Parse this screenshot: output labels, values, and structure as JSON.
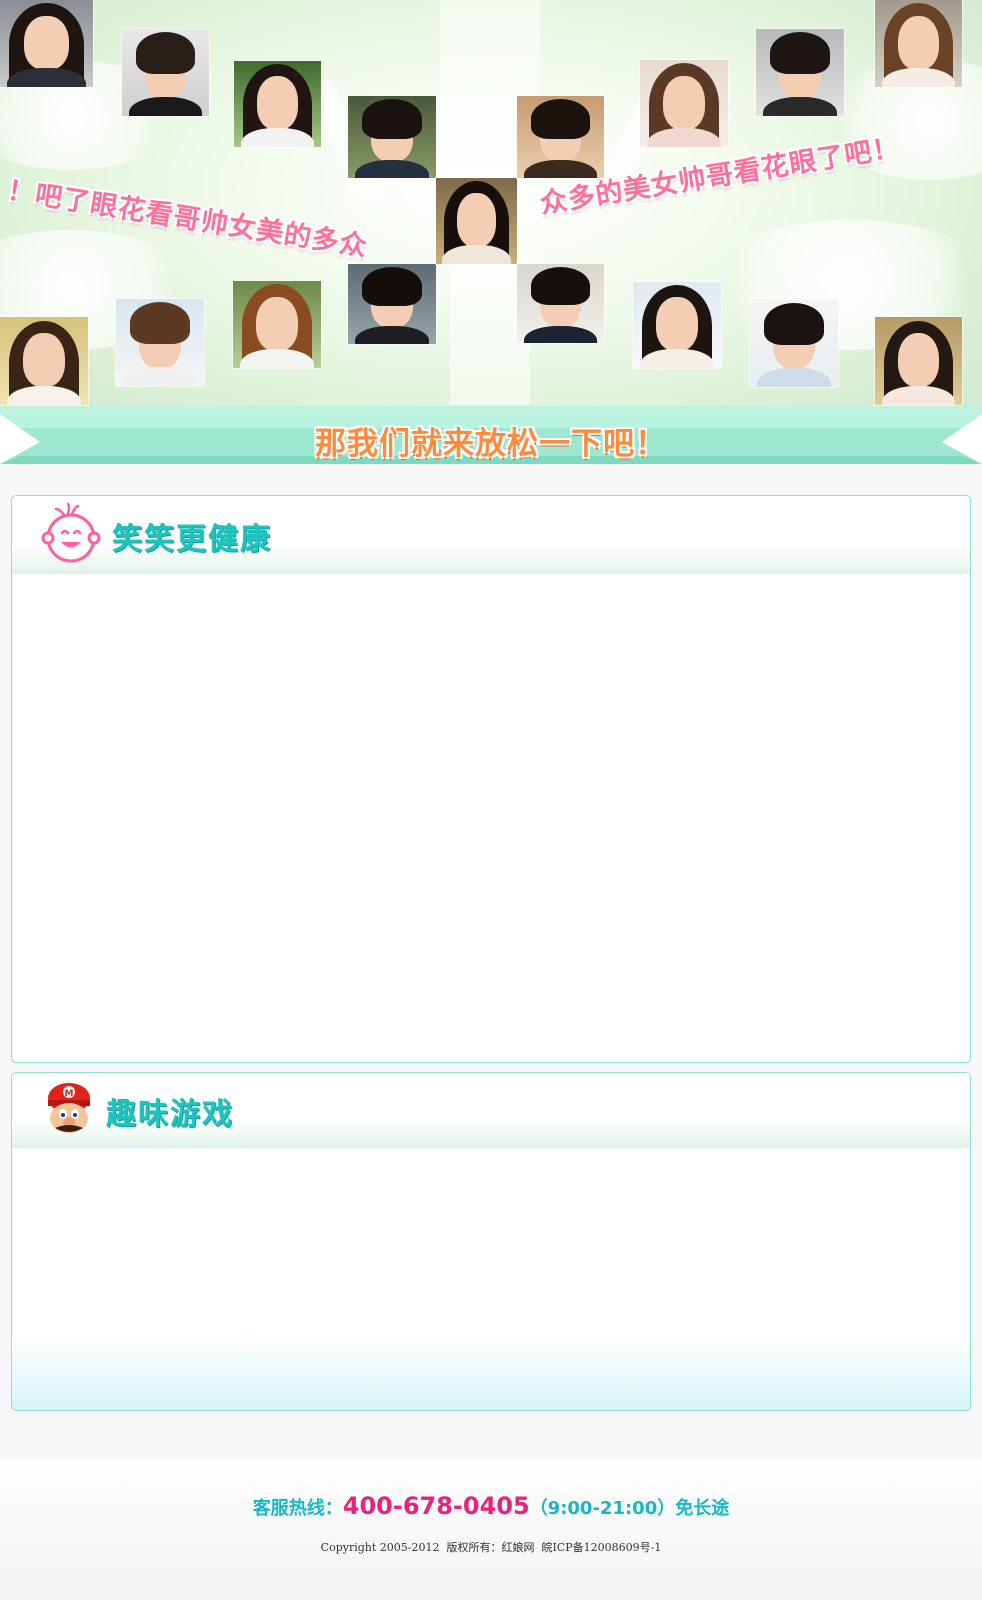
{
  "hero": {
    "slogan_left": "！吧了眼花看哥帅女美的多众",
    "slogan_right": "众多的美女帅哥看花眼了吧！",
    "photos": [
      {
        "name": "photo-woman-1"
      },
      {
        "name": "photo-man-1"
      },
      {
        "name": "photo-woman-2"
      },
      {
        "name": "photo-man-2"
      },
      {
        "name": "photo-man-3"
      },
      {
        "name": "photo-woman-3"
      },
      {
        "name": "photo-man-4"
      },
      {
        "name": "photo-woman-4"
      },
      {
        "name": "photo-woman-center"
      },
      {
        "name": "photo-woman-5"
      },
      {
        "name": "photo-man-5"
      },
      {
        "name": "photo-woman-6"
      },
      {
        "name": "photo-man-6"
      },
      {
        "name": "photo-man-7"
      },
      {
        "name": "photo-woman-7"
      },
      {
        "name": "photo-man-8"
      },
      {
        "name": "photo-woman-8"
      }
    ]
  },
  "ribbon": {
    "text": "那我们就来放松一下吧！"
  },
  "panels": {
    "jokes": {
      "title": "笑笑更健康",
      "icon": "smiley-face-icon"
    },
    "games": {
      "title": "趣味游戏",
      "icon": "mario-head-icon"
    }
  },
  "footer": {
    "hotline_label": "客服热线：",
    "hotline_number": "400-678-0405",
    "hotline_hours": "（9:00-21:00）免长途",
    "copyright": "Copyright 2005-2012  版权所有：红娘网  皖ICP备12008609号-1"
  },
  "colors": {
    "accent_teal": "#1fc4c0",
    "accent_pink": "#ff6f9b",
    "accent_orange": "#ff8a3c",
    "hotline_pink": "#e8237d"
  }
}
